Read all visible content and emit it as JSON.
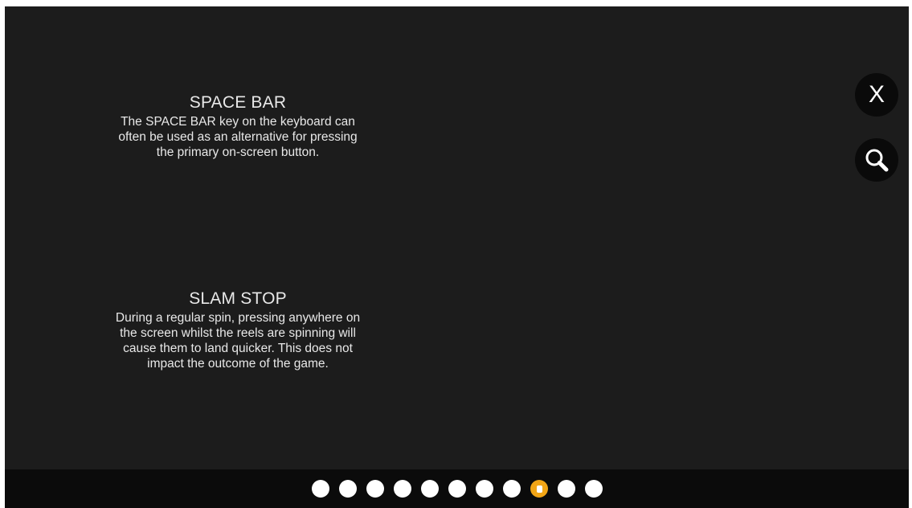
{
  "sections": [
    {
      "title": "SPACE BAR",
      "lines": [
        "The SPACE BAR key on the keyboard can",
        "often be used as an alternative for pressing",
        "the primary on-screen button."
      ]
    },
    {
      "title": "SLAM STOP",
      "lines": [
        "During a regular spin, pressing anywhere on",
        "the screen whilst the reels are spinning will",
        "cause them to land quicker. This does not",
        "impact the outcome of the game."
      ]
    }
  ],
  "controls": {
    "close_label": "X",
    "close_icon": "close-icon",
    "search_icon": "magnifier-icon"
  },
  "pagination": {
    "total_pages": 11,
    "current_page": 9,
    "active_color": "#f2a516",
    "inactive_color": "#ffffff"
  },
  "colors": {
    "background": "#1c1c1c",
    "footer": "#0b0b0b",
    "text": "#e8e8e8"
  }
}
